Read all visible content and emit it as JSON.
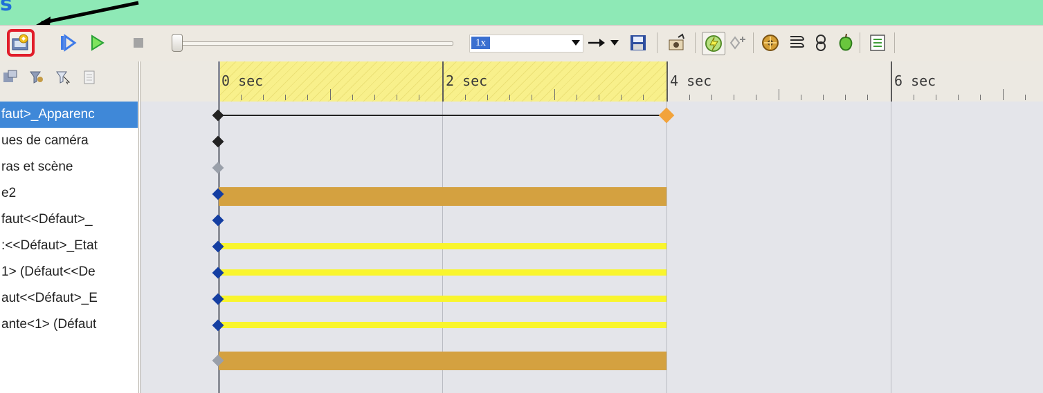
{
  "title_fragment": "s",
  "toolbar": {
    "speed": {
      "value": "1x"
    },
    "icons": {
      "calculate": "animation-wizard-icon",
      "play_from_start": "play-from-start-icon",
      "play": "play-icon",
      "stop": "stop-icon",
      "playback_mode": "playback-mode-icon",
      "save_animation": "save-animation-icon",
      "animation_wizard": "camera-wizard-icon",
      "autokey": "autokey-icon",
      "add_key": "add-key-icon",
      "motion": "motion-icon",
      "results": "results-icon",
      "motion_study_props": "properties-icon"
    },
    "highlight_color": "#e11d2a"
  },
  "tree": {
    "rows": [
      {
        "label": "faut>_Apparenc",
        "selected": true
      },
      {
        "label": "ues de caméra",
        "selected": false
      },
      {
        "label": "ras et scène",
        "selected": false
      },
      {
        "label": "e2",
        "selected": false
      },
      {
        "label": "faut<<Défaut>_",
        "selected": false
      },
      {
        "label": ":<<Défaut>_Etat",
        "selected": false
      },
      {
        "label": "1> (Défaut<<De",
        "selected": false
      },
      {
        "label": "aut<<Défaut>_E",
        "selected": false
      },
      {
        "label": "ante<1> (Défaut",
        "selected": false
      }
    ]
  },
  "timeline": {
    "ticks": [
      {
        "label": "0 sec",
        "seconds": 0
      },
      {
        "label": "2 sec",
        "seconds": 2
      },
      {
        "label": "4 sec",
        "seconds": 4
      },
      {
        "label": "6 sec",
        "seconds": 6
      }
    ],
    "highlight_end_seconds": 4,
    "colors": {
      "gold": "#d4a140",
      "yellow": "#f9f52d",
      "key_blue": "#143ea2",
      "key_orange": "#f2a33b"
    }
  }
}
